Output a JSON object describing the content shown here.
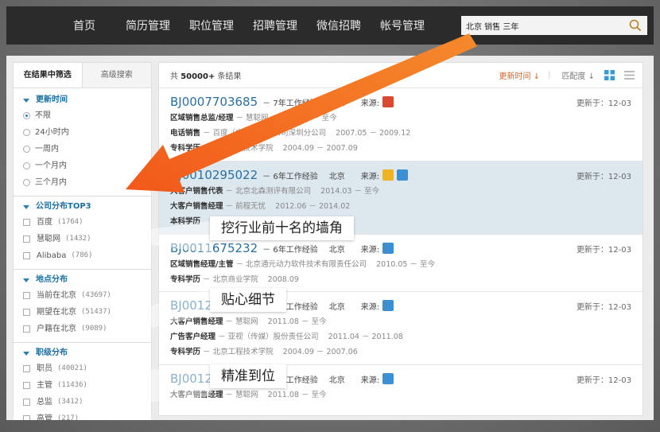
{
  "nav": {
    "items": [
      "首页",
      "简历管理",
      "职位管理",
      "招聘管理",
      "微信招聘",
      "帐号管理"
    ],
    "search_value": "北京 销售 三年"
  },
  "filters": {
    "tabs": [
      "在结果中筛选",
      "高级搜索"
    ],
    "update_time": {
      "title": "更新时间",
      "options": [
        "不限",
        "24小时内",
        "一周内",
        "一个月内",
        "三个月内"
      ],
      "selected": "不限"
    },
    "company": {
      "title": "公司分布TOP3",
      "options": [
        {
          "label": "百度",
          "count": "(1764)"
        },
        {
          "label": "慧聪网",
          "count": "(1432)"
        },
        {
          "label": "Alibaba",
          "count": "(786)"
        }
      ]
    },
    "location": {
      "title": "地点分布",
      "options": [
        {
          "label": "当前在北京",
          "count": "(43697)"
        },
        {
          "label": "期望在北京",
          "count": "(51437)"
        },
        {
          "label": "户籍在北京",
          "count": "(9089)"
        }
      ]
    },
    "level": {
      "title": "职级分布",
      "options": [
        {
          "label": "职员",
          "count": "(40021)"
        },
        {
          "label": "主管",
          "count": "(11436)"
        },
        {
          "label": "总监",
          "count": "(3412)"
        },
        {
          "label": "高管",
          "count": "(217)"
        }
      ]
    }
  },
  "results": {
    "total_prefix": "共",
    "total_count": "50000+",
    "total_suffix": "条结果",
    "sort_time": "更新时间",
    "sort_match": "匹配度",
    "items": [
      {
        "id": "BJ0007703685",
        "exp": "－ 7年工作经验",
        "city": "北京",
        "source_label": "来源:",
        "source_color": "#d8492f",
        "updated": "更新于：12-03",
        "lines": [
          {
            "title": "区域销售总监/经理",
            "org": "－ 慧聪网",
            "period": "2010.02 － 至今"
          },
          {
            "title": "电话销售",
            "org": "－ 百度（中国）有限公司深圳分公司",
            "period": "2007.05 － 2009.12"
          },
          {
            "title": "专科学历",
            "org": "－ 北京工程技术学院",
            "period": "2004.09 － 2007.09"
          }
        ]
      },
      {
        "id": "BJ0010295022",
        "exp": "－ 6年工作经验",
        "city": "北京",
        "source_label": "来源:",
        "source_color": "#f0b321",
        "updated": "更新于：12-03",
        "lines": [
          {
            "title": "大客户销售代表",
            "org": "－ 北京北森测评有限公司",
            "period": "2014.03 － 至今"
          },
          {
            "title": "大客户销售经理",
            "org": "－ 前程无忧",
            "period": "2012.06 － 2014.02"
          },
          {
            "title": "本科学历",
            "org": "",
            "period": ""
          }
        ]
      },
      {
        "id": "BJ0011675232",
        "exp": "－ 6年工作经验",
        "city": "北京",
        "source_label": "来源:",
        "source_color": "#3c8fd0",
        "updated": "更新于：12-03",
        "lines": [
          {
            "title": "区域销售经理/主管",
            "org": "－ 北京通元动力软件技术有限责任公司",
            "period": "2010.05 － 至今"
          },
          {
            "title": "专科学历",
            "org": "－ 北京商业学院",
            "period": "2008.09"
          }
        ]
      },
      {
        "id": "BJ0012170049",
        "exp": "－ 7年工作经验",
        "city": "北京",
        "source_label": "来源:",
        "source_color": "#3c8fd0",
        "updated": "更新于：12-03",
        "lines": [
          {
            "title": "大客户销售经理",
            "org": "－ 慧聪网",
            "period": "2011.08 － 至今"
          },
          {
            "title": "广告客户经理",
            "org": "－ 亚视（传媒）股份责任公司",
            "period": "2011.04 － 2011.08"
          },
          {
            "title": "专科学历",
            "org": "－ 北京工程技术学院",
            "period": "2004.09 － 2007.06"
          }
        ]
      },
      {
        "id": "BJ0012170050",
        "exp": "－ 7年工作经验",
        "city": "北京",
        "source_label": "来源:",
        "source_color": "#3c8fd0",
        "updated": "更新于：12-03",
        "lines": [
          {
            "title": "大客户销售经理",
            "org": "－ 慧聪网",
            "period": "2011.08 － 至今"
          }
        ]
      }
    ]
  },
  "callouts": [
    "挖行业前十名的墙角",
    "贴心细节",
    "精准到位"
  ],
  "colors": {
    "accent": "#f06a1c",
    "link": "#2a6fa2",
    "nav_bg": "#2b2b2b"
  }
}
